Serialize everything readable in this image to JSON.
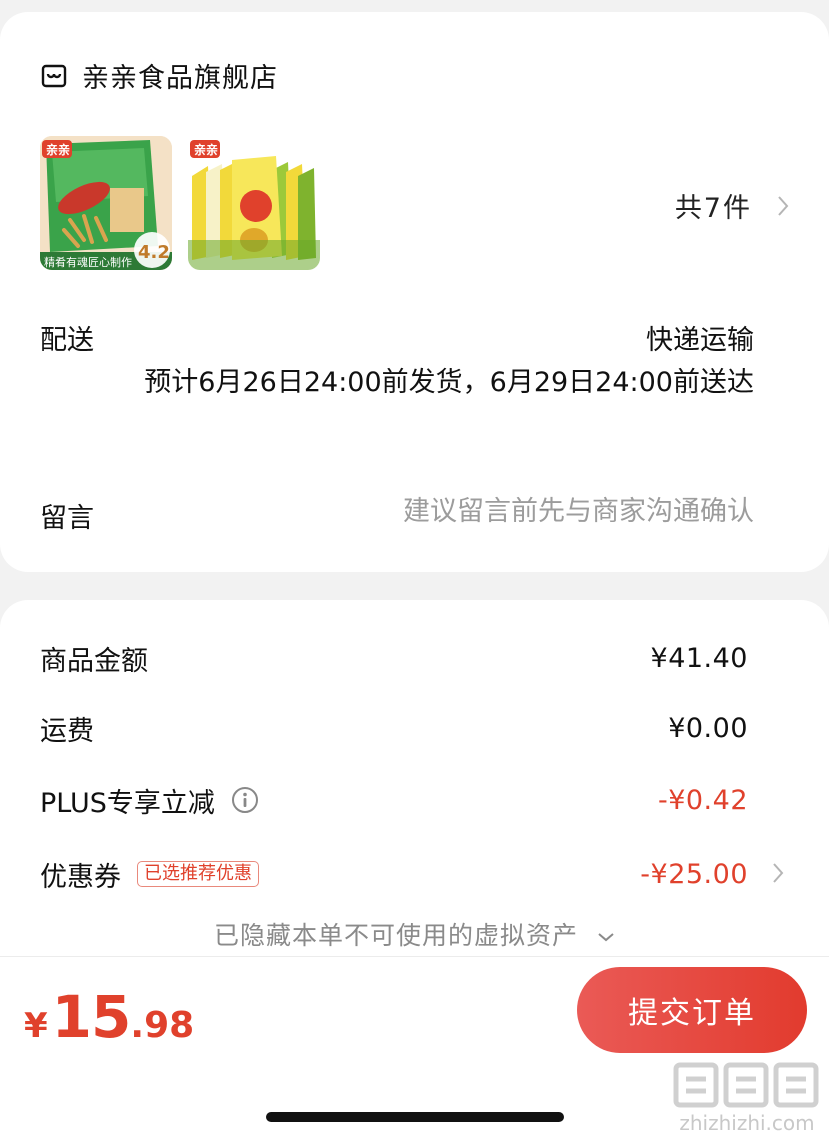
{
  "store": {
    "name": "亲亲食品旗舰店",
    "item_count": "共7件",
    "thumb1_badge": "4.2",
    "thumb1_banner": "精肴有魂匠心制作",
    "thumb1_brand": "亲亲"
  },
  "delivery": {
    "label": "配送",
    "method": "快递运输",
    "estimate": "预计6月26日24:00前发货，6月29日24:00前送达"
  },
  "note": {
    "label": "留言",
    "placeholder": "建议留言前先与商家沟通确认"
  },
  "costs": {
    "goods_label": "商品金额",
    "goods_value": "¥41.40",
    "shipping_label": "运费",
    "shipping_value": "¥0.00",
    "plus_label": "PLUS专享立减",
    "plus_value": "-¥0.42",
    "coupon_label": "优惠券",
    "coupon_badge": "已选推荐优惠",
    "coupon_value": "-¥25.00"
  },
  "hidden_assets_text": "已隐藏本单不可使用的虚拟资产",
  "footer": {
    "currency": "¥",
    "total_int": "15",
    "total_dec": ".98",
    "submit_label": "提交订单"
  },
  "watermark": {
    "glyphs": "值值值",
    "url": "zhizhizhi.com"
  },
  "colors": {
    "accent_red": "#e0412c",
    "button_gradient_start": "#ea5a56",
    "button_gradient_end": "#e23b2e"
  }
}
